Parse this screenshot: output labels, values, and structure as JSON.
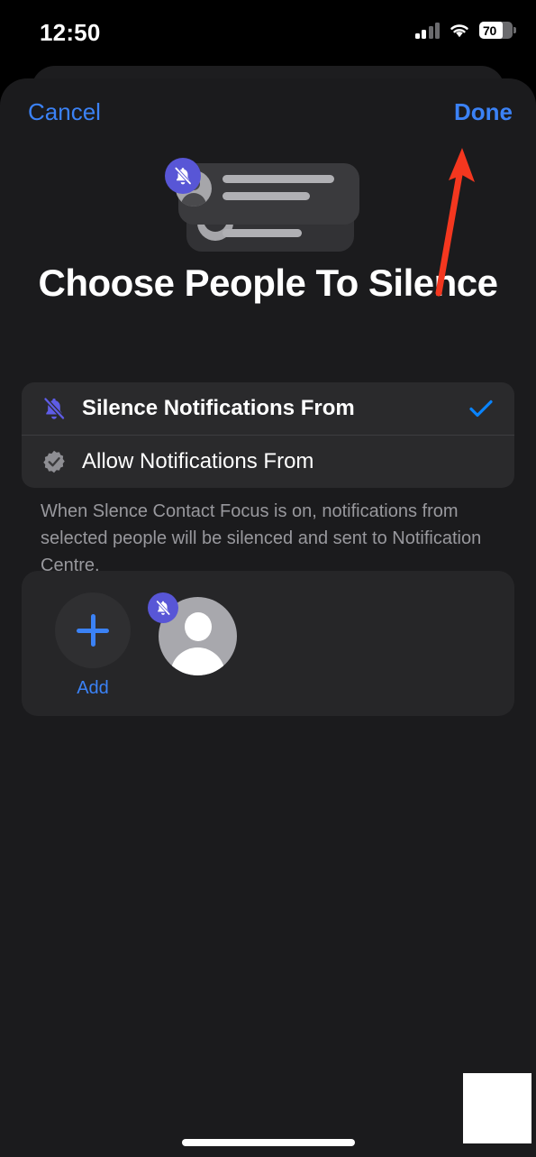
{
  "status_bar": {
    "time": "12:50",
    "battery_percent": "70",
    "battery_level": 70,
    "cellular_icon": "cellular-bars-icon",
    "wifi_icon": "wifi-icon",
    "battery_icon": "battery-icon"
  },
  "sheet": {
    "cancel_label": "Cancel",
    "done_label": "Done"
  },
  "hero": {
    "badge_icon": "bell-slash-icon",
    "illustration_name": "notification-cards-illustration"
  },
  "title": "Choose People To Silence",
  "options": [
    {
      "label": "Silence Notifications From",
      "icon": "bell-slash-icon",
      "selected": true,
      "check_icon": "checkmark-icon"
    },
    {
      "label": "Allow Notifications From",
      "icon": "checkmark-seal-icon",
      "selected": false,
      "check_icon": ""
    }
  ],
  "footnote": "When Slence Contact Focus is on, notifications from selected people will be silenced and sent to Notification Centre.",
  "people": {
    "add_label": "Add",
    "add_icon": "plus-icon",
    "contact_avatar_icon": "person-avatar-icon",
    "contact_badge_icon": "bell-slash-icon"
  },
  "annotation": {
    "arrow_icon": "red-arrow-icon",
    "arrow_color": "#f4371f",
    "points_to": "Done"
  },
  "colors": {
    "accent_blue": "#3b82f6",
    "check_blue": "#0a84ff",
    "focus_purple": "#5856d6",
    "sheet_bg": "#1b1b1d",
    "group_bg": "#2a2a2c",
    "card_bg": "#262628",
    "screen_bg": "#000000",
    "secondary_text": "#98989d"
  },
  "home_indicator": "home-indicator"
}
